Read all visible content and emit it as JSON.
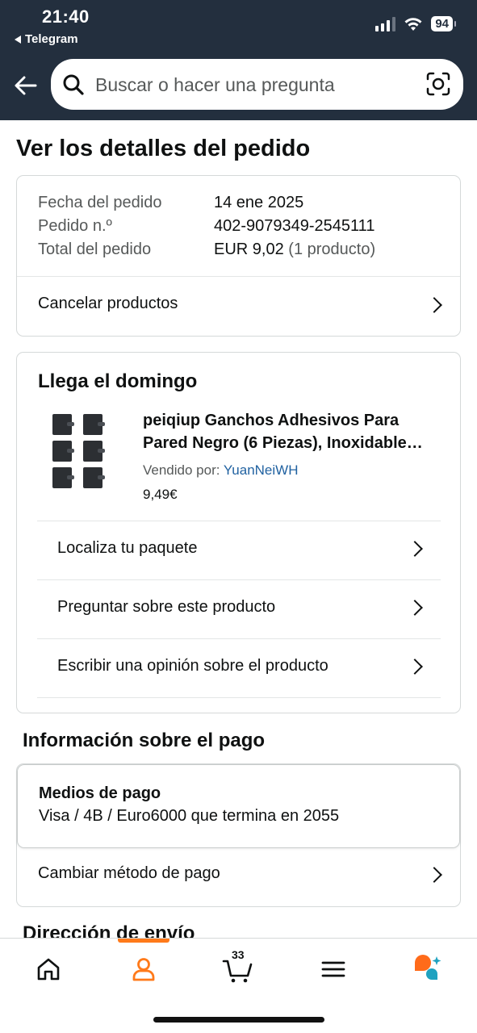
{
  "status_bar": {
    "time": "21:40",
    "back_app": "Telegram",
    "battery": "94"
  },
  "search": {
    "placeholder": "Buscar o hacer una pregunta"
  },
  "page_title": "Ver los detalles del pedido",
  "order_summary": {
    "rows": [
      {
        "label": "Fecha del pedido",
        "value": "14 ene 2025"
      },
      {
        "label": "Pedido n.º",
        "value": "402-9079349-2545111"
      },
      {
        "label": "Total del pedido",
        "value": "EUR 9,02",
        "extra": "(1 producto)"
      }
    ],
    "cancel_link": "Cancelar productos"
  },
  "shipment": {
    "arrival": "Llega el domingo",
    "product_title": "peiqiup Ganchos Adhesivos Para Pared Negro (6 Piezas), Inoxidable…",
    "sold_by_label": "Vendido por:",
    "seller": "YuanNeiWH",
    "price": "9,49€",
    "actions": [
      "Localiza tu paquete",
      "Preguntar sobre este producto",
      "Escribir una opinión sobre el producto"
    ]
  },
  "payment": {
    "section_title": "Información sobre el pago",
    "methods_label": "Medios de pago",
    "methods_value": "Visa / 4B / Euro6000  que termina en 2055",
    "change_link": "Cambiar método de pago"
  },
  "shipping_address": {
    "section_title": "Dirección de envío"
  },
  "bottom_nav": {
    "cart_count": "33",
    "active": "account",
    "accent": "#ff7a1a"
  }
}
